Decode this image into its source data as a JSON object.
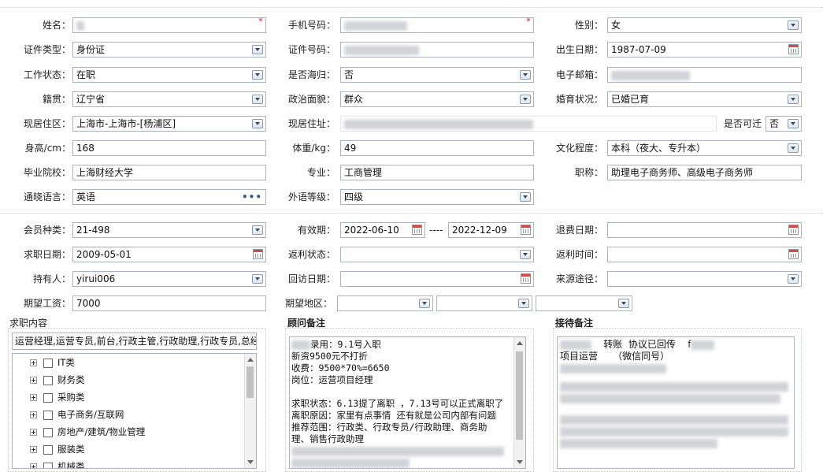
{
  "row1": {
    "name_label": "姓名：",
    "name_value": "",
    "phone_label": "手机号码：",
    "phone_value": "",
    "gender_label": "性别：",
    "gender_value": "女"
  },
  "row2": {
    "idtype_label": "证件类型：",
    "idtype_value": "身份证",
    "idnum_label": "证件号码：",
    "idnum_value": "",
    "birth_label": "出生日期：",
    "birth_value": "1987-07-09"
  },
  "row3": {
    "work_label": "工作状态：",
    "work_value": "在职",
    "overseas_label": "是否海归：",
    "overseas_value": "否",
    "email_label": "电子邮箱：",
    "email_value": ""
  },
  "row4": {
    "native_label": "籍贯：",
    "native_value": "辽宁省",
    "political_label": "政治面貌：",
    "political_value": "群众",
    "marital_label": "婚育状况：",
    "marital_value": "已婚已育"
  },
  "row5": {
    "region_label": "现居住区：",
    "region_value": "上海市-上海市-[杨浦区]",
    "address_label": "现居住址：",
    "address_value": "",
    "relocate_label": "是否可迁",
    "relocate_value": "否"
  },
  "row6": {
    "height_label": "身高/cm：",
    "height_value": "168",
    "weight_label": "体重/kg：",
    "weight_value": "49",
    "edu_label": "文化程度：",
    "edu_value": "本科（夜大、专升本）"
  },
  "row7": {
    "school_label": "毕业院校：",
    "school_value": "上海财经大学",
    "major_label": "专业：",
    "major_value": "工商管理",
    "title_label": "职称：",
    "title_value": "助理电子商务师、高级电子商务师"
  },
  "row8": {
    "lang_label": "通晓语言：",
    "lang_value": "英语",
    "langlevel_label": "外语等级：",
    "langlevel_value": "四级"
  },
  "row9": {
    "member_label": "会员种类：",
    "member_value": "21-498",
    "valid_label": "有效期：",
    "valid_from": "2022-06-10",
    "valid_sep": "----",
    "valid_to": "2022-12-09",
    "refund_label": "退费日期：",
    "refund_value": ""
  },
  "row10": {
    "jobdate_label": "求职日期：",
    "jobdate_value": "2009-05-01",
    "rebate_label": "返利状态：",
    "rebate_value": "",
    "rebatetime_label": "返利时间：",
    "rebatetime_value": ""
  },
  "row11": {
    "holder_label": "持有人：",
    "holder_value": "yirui006",
    "visit_label": "回访日期：",
    "visit_value": "",
    "source_label": "来源途径：",
    "source_value": ""
  },
  "row12": {
    "salary_label": "期望工资：",
    "salary_value": "7000",
    "area_label": "期望地区："
  },
  "job_section": {
    "title": "求职内容",
    "selected": "运营经理,运营专员,前台,行政主管,行政助理,行政专员,总经",
    "tree": [
      "IT类",
      "财务类",
      "采购类",
      "电子商务/互联网",
      "房地产/建筑/物业管理",
      "服装类",
      "机械类"
    ]
  },
  "consultant_section": {
    "title": "顾问备注",
    "lines": [
      "录用：9.1号入职",
      "新资9500元不打折",
      "收费：9500*70%=6650",
      "岗位：运营项目经理",
      "",
      "求职状态：6.13提了离职 ，7.13号可以正式离职了",
      "离职原因：家里有点事情 还有就是公司内部有问题",
      "推荐范围：行政类、行政专员/行政助理、商务助",
      "理、销售行政助理"
    ]
  },
  "reception_section": {
    "title": "接待备注",
    "line1_a": "转账",
    "line1_b": "协议已回传",
    "line1_c": "f",
    "line2": "项目运营     （微信同号）"
  }
}
